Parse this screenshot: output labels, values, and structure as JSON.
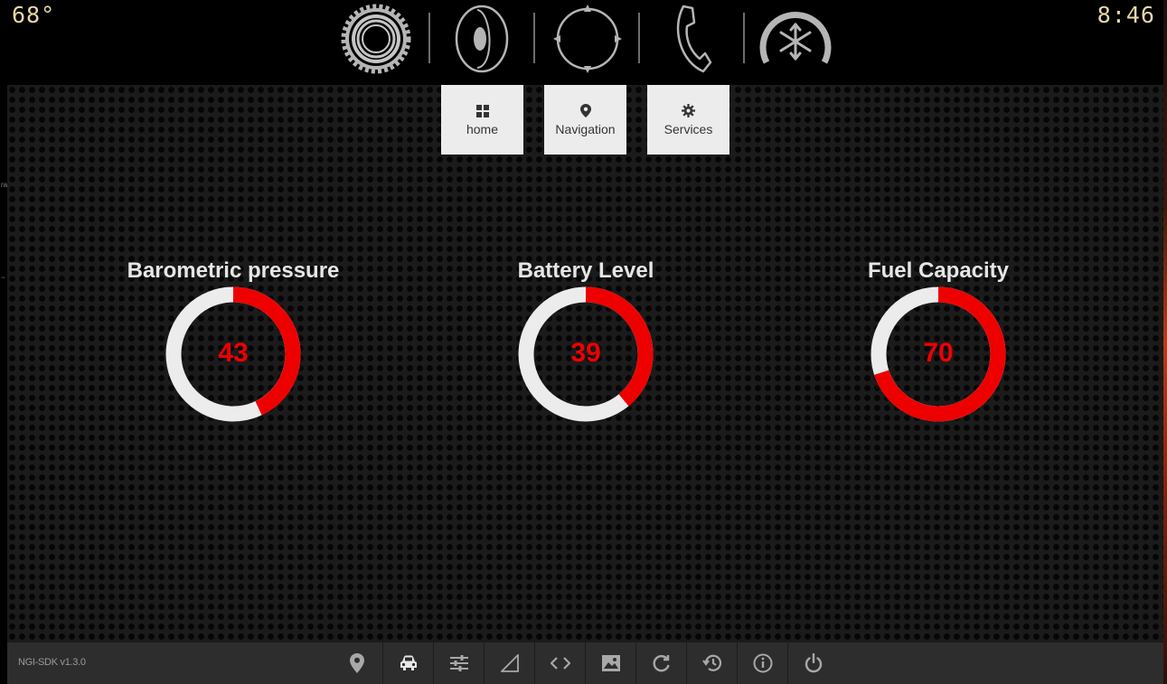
{
  "status": {
    "temperature": "68°",
    "time": "8:46"
  },
  "top_icons": [
    "gear-dial-icon",
    "speaker-icon",
    "compass-icon",
    "phone-icon",
    "climate-fan-icon"
  ],
  "tabs": [
    {
      "label": "home",
      "icon": "grid-icon"
    },
    {
      "label": "Navigation",
      "icon": "map-pin-icon"
    },
    {
      "label": "Services",
      "icon": "gear-icon"
    }
  ],
  "gauges": [
    {
      "title": "Barometric pressure",
      "value": "43",
      "percent": 43
    },
    {
      "title": "Battery Level",
      "value": "39",
      "percent": 39
    },
    {
      "title": "Fuel Capacity",
      "value": "70",
      "percent": 70
    }
  ],
  "colors": {
    "gauge_fill": "#ee0000",
    "gauge_track": "#ececec",
    "accent_text": "#e7d9a8"
  },
  "footer": {
    "version": "NGI-SDK v1.3.0",
    "icons": [
      "map-pin-icon",
      "car-icon",
      "sliders-icon",
      "signal-icon",
      "code-icon",
      "image-icon",
      "refresh-icon",
      "history-icon",
      "info-icon",
      "power-icon"
    ]
  }
}
